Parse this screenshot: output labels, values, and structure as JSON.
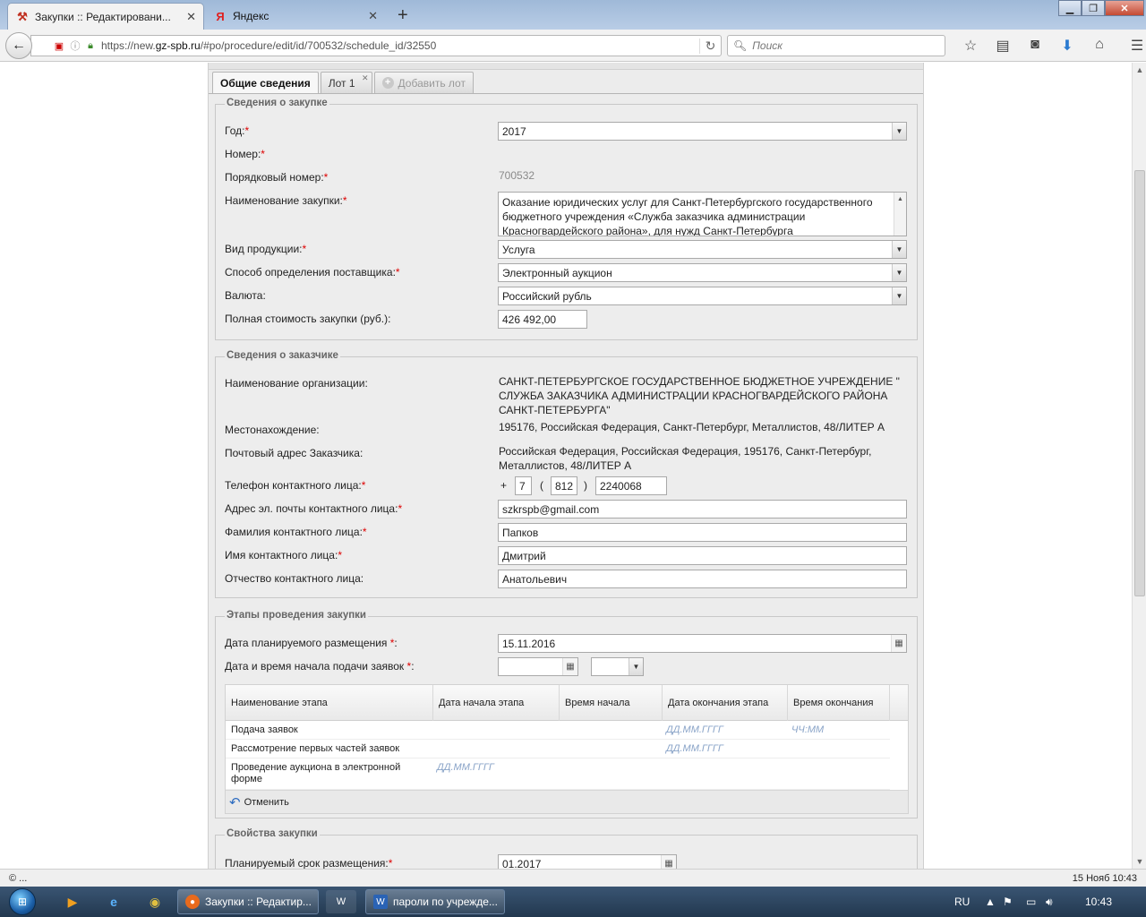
{
  "browser": {
    "tabs": [
      {
        "title": "Закупки :: Редактировани...",
        "active": true
      },
      {
        "title": "Яндекс",
        "active": false
      }
    ],
    "url_prefix": "https://new.",
    "url_domain": "gz-spb.ru",
    "url_path": "/#po/procedure/edit/id/700532/schedule_id/32550",
    "search_placeholder": "Поиск"
  },
  "page_tabs": {
    "general": "Общие сведения",
    "lot": "Лот 1",
    "add_lot": "Добавить лот"
  },
  "procurement": {
    "legend": "Сведения о закупке",
    "year_label": "Год:",
    "year_value": "2017",
    "number_label": "Номер:",
    "serial_label": "Порядковый номер:",
    "serial_value": "700532",
    "name_label": "Наименование закупки:",
    "name_value": "Оказание юридических услуг для Санкт-Петербургского государственного бюджетного учреждения «Служба заказчика администрации Красногвардейского района», для нужд Санкт-Петербурга",
    "product_label": "Вид продукции:",
    "product_value": "Услуга",
    "method_label": "Способ определения поставщика:",
    "method_value": "Электронный аукцион",
    "currency_label": "Валюта:",
    "currency_value": "Российский рубль",
    "cost_label": "Полная стоимость закупки (руб.):",
    "cost_value": "426 492,00"
  },
  "customer": {
    "legend": "Сведения о заказчике",
    "org_label": "Наименование организации:",
    "org_value": "САНКТ-ПЕТЕРБУРГСКОЕ ГОСУДАРСТВЕННОЕ БЮДЖЕТНОЕ УЧРЕЖДЕНИЕ \" СЛУЖБА ЗАКАЗЧИКА АДМИНИСТРАЦИИ КРАСНОГВАРДЕЙСКОГО РАЙОНА САНКТ-ПЕТЕРБУРГА\"",
    "location_label": "Местонахождение:",
    "location_value": "195176, Российская Федерация, Санкт-Петербург, Металлистов, 48/ЛИТЕР А",
    "postal_label": "Почтовый адрес Заказчика:",
    "postal_value": "Российская Федерация, Российская Федерация, 195176, Санкт-Петербург, Металлистов, 48/ЛИТЕР А",
    "phone_label": "Телефон контактного лица:",
    "phone_plus": "+",
    "phone_country": "7",
    "phone_open": "(",
    "phone_code": "812",
    "phone_close": ")",
    "phone_number": "2240068",
    "email_label": "Адрес эл. почты контактного лица:",
    "email_value": "szkrspb@gmail.com",
    "surname_label": "Фамилия контактного лица:",
    "surname_value": "Папков",
    "firstname_label": "Имя контактного лица:",
    "firstname_value": "Дмитрий",
    "patronymic_label": "Отчество контактного лица:",
    "patronymic_value": "Анатольевич"
  },
  "stages": {
    "legend": "Этапы проведения закупки",
    "planned_date_label": "Дата планируемого размещения ",
    "planned_date_value": "15.11.2016",
    "start_label": "Дата и время начала подачи заявок ",
    "columns": [
      "Наименование этапа",
      "Дата начала этапа",
      "Время начала",
      "Дата окончания этапа",
      "Время окончания"
    ],
    "rows": [
      {
        "name": "Подача заявок",
        "start_date": "",
        "start_time": "",
        "end_date": "ДД.ММ.ГГГГ",
        "end_time": "ЧЧ:ММ"
      },
      {
        "name": "Рассмотрение первых частей заявок",
        "start_date": "",
        "start_time": "",
        "end_date": "ДД.ММ.ГГГГ",
        "end_time": ""
      },
      {
        "name": "Проведение аукциона в электронной форме",
        "start_date": "ДД.ММ.ГГГГ",
        "start_time": "",
        "end_date": "",
        "end_time": ""
      }
    ],
    "undo_label": "Отменить"
  },
  "properties": {
    "legend": "Свойства закупки",
    "term_label": "Планируемый срок размещения:",
    "term_value": "01.2017"
  },
  "status": {
    "left": "© ...",
    "right": "15 Нояб 10:43"
  },
  "taskbar": {
    "tasks": [
      "Закупки :: Редактир...",
      "пароли по учрежде..."
    ],
    "lang": "RU",
    "time": "10:43"
  }
}
